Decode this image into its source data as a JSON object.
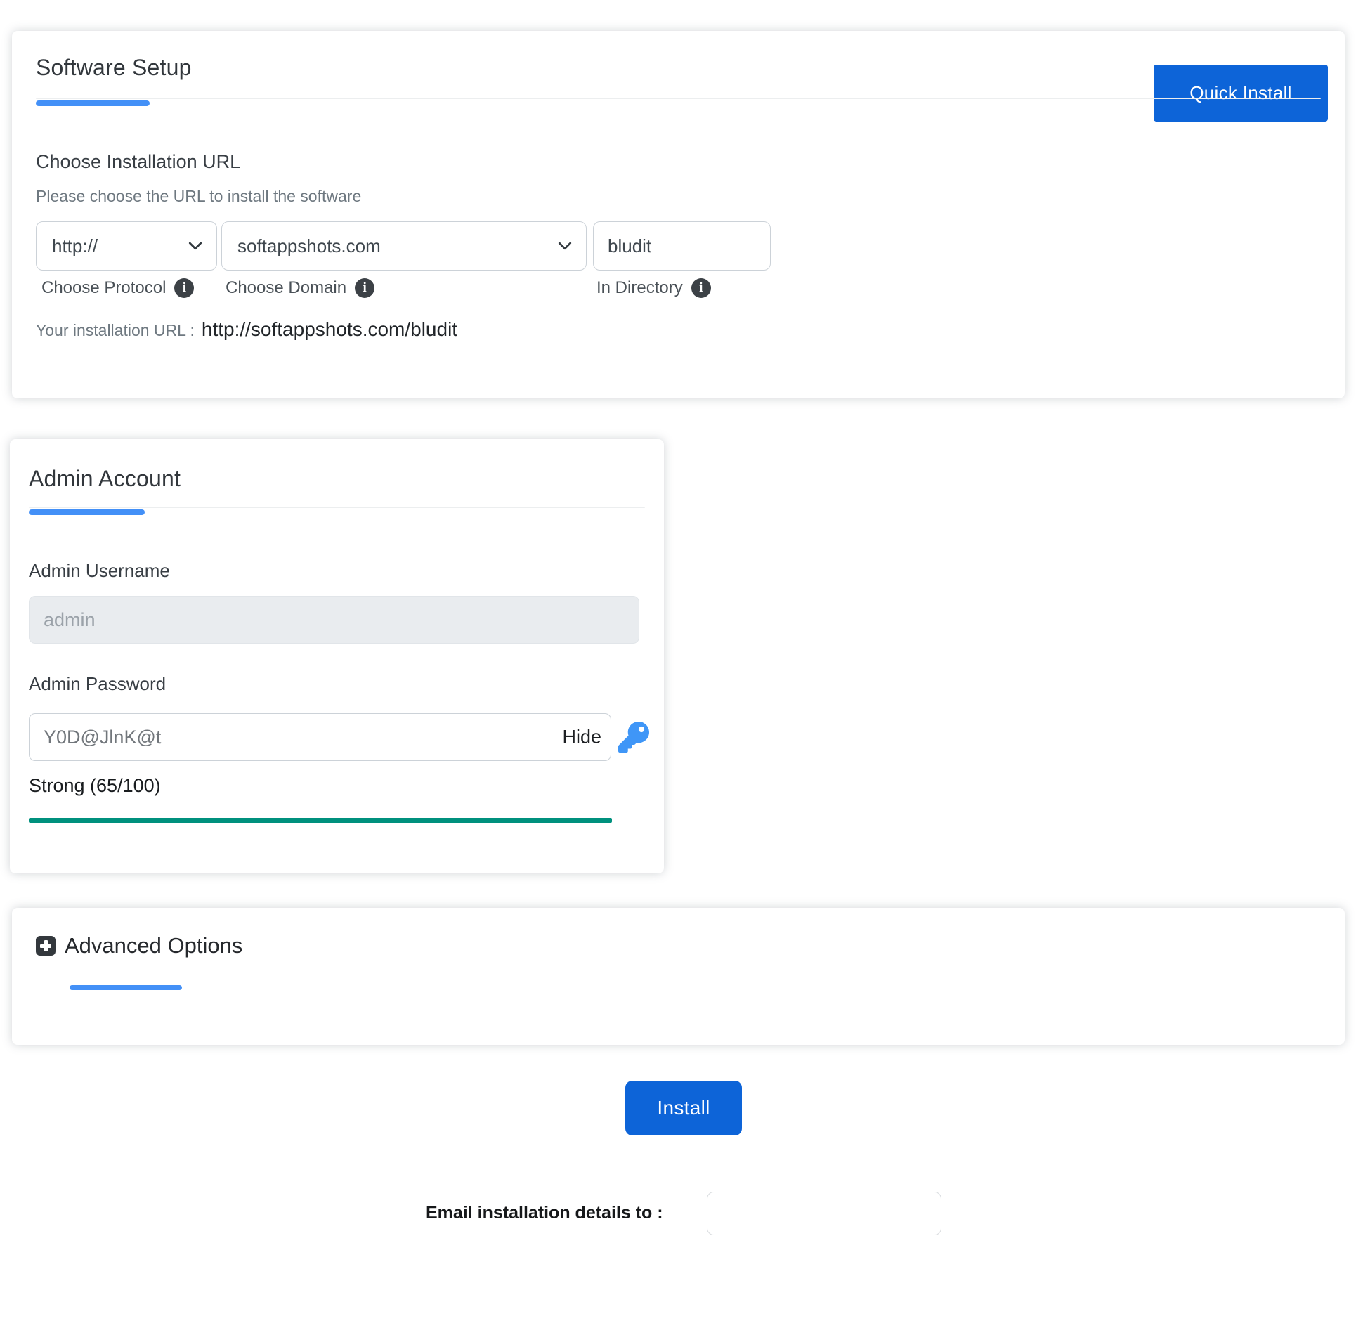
{
  "colors": {
    "primary_button": "#0d64d8",
    "accent_underline": "#4390f7",
    "strength_bar": "#00917e",
    "key_icon": "#3f96f7",
    "info_icon_bg": "#3c4146"
  },
  "software_setup": {
    "title": "Software Setup",
    "quick_install_button": "Quick Install",
    "choose_url_heading": "Choose Installation URL",
    "choose_url_subtitle": "Please choose the URL to install the software",
    "protocol_value": "http://",
    "protocol_label": "Choose Protocol",
    "domain_value": "softappshots.com",
    "domain_label": "Choose Domain",
    "directory_value": "bludit",
    "directory_label": "In Directory",
    "installation_url_label": "Your installation URL :",
    "installation_url_value": "http://softappshots.com/bludit"
  },
  "admin_account": {
    "title": "Admin Account",
    "username_label": "Admin Username",
    "username_value": "admin",
    "password_label": "Admin Password",
    "password_value": "Y0D@JlnK@t",
    "hide_toggle": "Hide",
    "strength_text": "Strong (65/100)",
    "strength_bar_percent": 100
  },
  "advanced_options": {
    "title": "Advanced Options"
  },
  "footer": {
    "install_button": "Install",
    "email_label": "Email installation details to :",
    "email_value": ""
  },
  "icons": {
    "protocol_info": "info-icon",
    "domain_info": "info-icon",
    "directory_info": "info-icon",
    "password_key": "key-icon",
    "advanced_plus": "plus-square-icon",
    "select_chevron": "chevron-down-icon"
  }
}
